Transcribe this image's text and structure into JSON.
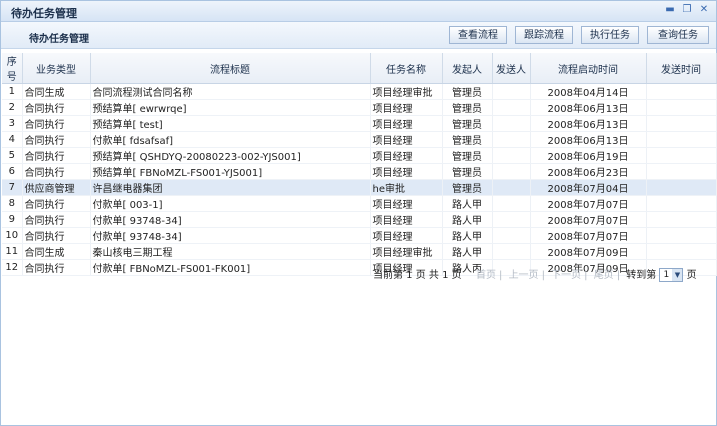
{
  "window": {
    "title": "待办任务管理",
    "controls": {
      "minimize": "▬",
      "restore": "❐",
      "close": "✕"
    }
  },
  "toolbar": {
    "subtitle": "待办任务管理",
    "buttons": [
      "查看流程",
      "跟踪流程",
      "执行任务",
      "查询任务"
    ]
  },
  "table": {
    "headers": [
      "序号",
      "业务类型",
      "流程标题",
      "任务名称",
      "发起人",
      "发送人",
      "流程启动时间",
      "发送时间"
    ],
    "rows": [
      [
        "1",
        "合同生成",
        "合同流程测试合同名称",
        "项目经理审批",
        "管理员",
        "",
        "2008年04月14日",
        ""
      ],
      [
        "2",
        "合同执行",
        "预结算单[ ewrwrqe]",
        "项目经理",
        "管理员",
        "",
        "2008年06月13日",
        ""
      ],
      [
        "3",
        "合同执行",
        "预结算单[ test]",
        "项目经理",
        "管理员",
        "",
        "2008年06月13日",
        ""
      ],
      [
        "4",
        "合同执行",
        "付款单[ fdsafsaf]",
        "项目经理",
        "管理员",
        "",
        "2008年06月13日",
        ""
      ],
      [
        "5",
        "合同执行",
        "预结算单[ QSHDYQ-20080223-002-YJS001]",
        "项目经理",
        "管理员",
        "",
        "2008年06月19日",
        ""
      ],
      [
        "6",
        "合同执行",
        "预结算单[ FBNoMZL-FS001-YJS001]",
        "项目经理",
        "管理员",
        "",
        "2008年06月23日",
        ""
      ],
      [
        "7",
        "供应商管理",
        "许昌继电器集团",
        "he审批",
        "管理员",
        "",
        "2008年07月04日",
        ""
      ],
      [
        "8",
        "合同执行",
        "付款单[ 003-1]",
        "项目经理",
        "路人甲",
        "",
        "2008年07月07日",
        ""
      ],
      [
        "9",
        "合同执行",
        "付款单[ 93748-34]",
        "项目经理",
        "路人甲",
        "",
        "2008年07月07日",
        ""
      ],
      [
        "10",
        "合同执行",
        "付款单[ 93748-34]",
        "项目经理",
        "路人甲",
        "",
        "2008年07月07日",
        ""
      ],
      [
        "11",
        "合同生成",
        "秦山核电三期工程",
        "项目经理审批",
        "路人甲",
        "",
        "2008年07月09日",
        ""
      ],
      [
        "12",
        "合同执行",
        "付款单[ FBNoMZL-FS001-FK001]",
        "项目经理",
        "路人丙",
        "",
        "2008年07月09日",
        ""
      ]
    ],
    "highlighted_row": 7
  },
  "pager": {
    "current_text": "当前第 1 页 共 1 页",
    "first": "首页",
    "prev": "上一页",
    "next": "下一页",
    "last": "尾页",
    "goto_label": "转到第",
    "page_value": "1",
    "page_suffix": "页"
  },
  "colors": {
    "accent": "#3a6ab0",
    "highlight_row": "#dfe9f6",
    "disabled": "#b5bcc6"
  }
}
